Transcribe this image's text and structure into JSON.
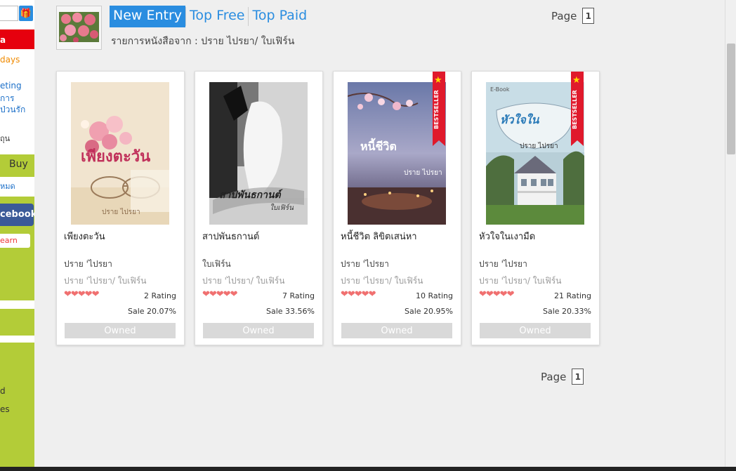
{
  "sidebar": {
    "red_bar_text": "a",
    "holidays_text": "days",
    "marketing_line1": "eting",
    "marketing_line2": "การ",
    "marketing_line3": "ป่วนรัก",
    "small_text": "ถุน",
    "buy_label": "Buy",
    "all_label": "หมด",
    "facebook_label": "cebook",
    "learn_label": "earn",
    "bottom_text1": "d",
    "bottom_text2": "es"
  },
  "header": {
    "tabs": [
      {
        "label": "New Entry",
        "active": true
      },
      {
        "label": "Top Free",
        "active": false
      },
      {
        "label": "Top Paid",
        "active": false
      }
    ],
    "subtitle": "รายการหนังสือจาก : ปราย ไปรยา/ ใบเฟิร์น"
  },
  "pagination": {
    "label": "Page",
    "current": "1"
  },
  "books": [
    {
      "title": "เพียงตะวัน",
      "author": "ปราย 'ไปรยา",
      "publisher": "ปราย 'ไปรยา/ ใบเฟิร์น",
      "hearts": "❤❤❤❤❤",
      "rating": "2 Rating",
      "sale": "Sale 20.07%",
      "button": "Owned",
      "bestseller": false,
      "cover_title": "เพียงตะวัน",
      "cover_author": "ปราย ไปรยา"
    },
    {
      "title": "สาปพันธกานต์",
      "author": "ใบเฟิร์น",
      "publisher": "ปราย 'ไปรยา/ ใบเฟิร์น",
      "hearts": "❤❤❤❤❤",
      "rating": "7 Rating",
      "sale": "Sale 33.56%",
      "button": "Owned",
      "bestseller": false,
      "cover_title": "สาปพันธกานต์",
      "cover_author": "ใบเฟิร์น"
    },
    {
      "title": "หนี้ชีวิต ลิขิตเสน่หา",
      "author": "ปราย 'ไปรยา",
      "publisher": "ปราย 'ไปรยา/ ใบเฟิร์น",
      "hearts": "❤❤❤❤❤",
      "rating": "10 Rating",
      "sale": "Sale 20.95%",
      "button": "Owned",
      "bestseller": true,
      "badge_label": "BESTSELLER",
      "cover_title": "หนี้ชีวิต",
      "cover_author": "ปราย ไปรยา"
    },
    {
      "title": "หัวใจในเงามืด",
      "author": "ปราย 'ไปรยา",
      "publisher": "ปราย 'ไปรยา/ ใบเฟิร์น",
      "hearts": "❤❤❤❤❤",
      "rating": "21 Rating",
      "sale": "Sale 20.33%",
      "button": "Owned",
      "bestseller": true,
      "badge_label": "BESTSELLER",
      "cover_title": "หัวใจใน",
      "cover_label": "E-Book",
      "cover_author": "ปราย ไปรยา"
    }
  ],
  "colors": {
    "accent": "#2a8de0",
    "sidebar_green": "#b3cc38",
    "bestseller_red": "#e0192c",
    "heart": "#f07070"
  }
}
